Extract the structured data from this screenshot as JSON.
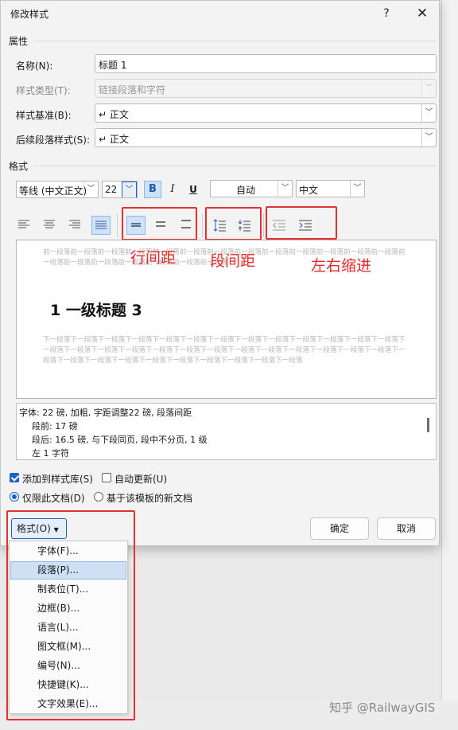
{
  "window": {
    "title": "修改样式",
    "help_icon": "?",
    "close_icon": "✕"
  },
  "properties": {
    "section_label": "属性",
    "name_label": "名称(N):",
    "name_value": "标题 1",
    "style_type_label": "样式类型(T):",
    "style_type_value": "链接段落和字符",
    "based_on_label": "样式基准(B):",
    "based_on_value": "↵ 正文",
    "following_label": "后续段落样式(S):",
    "following_value": "↵ 正文"
  },
  "formatting": {
    "section_label": "格式",
    "font_value": "等线 (中文正文)",
    "size_value": "22",
    "bold": "B",
    "italic": "I",
    "underline": "U",
    "color_value": "自动",
    "script_value": "中文"
  },
  "annotations": {
    "line_spacing": "行间距",
    "para_spacing": "段间距",
    "indent": "左右缩进"
  },
  "preview": {
    "prev_text": "前一段落前一段落前一段落前一段落前一段落前一段落前一段落前一段落前一段落前一段落前一段落前一段落前一段落前一段落前一段落前一段落前一段落前一段落前一段落前一段落",
    "heading": "1  一级标题 3",
    "next_text": "下一段落下一段落下一段落下一段落下一段落下一段落下一段落下一段落下一段落下一段落下一段落下一段落下一段落下一段落下一段落下一段落下一段落下一段落下一段落下一段落下一段落下一段落下一段落下一段落下一段落下一段落下一段落下一段落下一段落下一段落下一段落下一段落下一段落下一段落下一段落下一段落"
  },
  "description": {
    "line1": "字体: 22 磅, 加粗, 字距调整22 磅, 段落间距",
    "line2": "段前: 17 磅",
    "line3": "段后: 16.5 磅, 与下段同页, 段中不分页, 1 级",
    "line4": "左  1 字符"
  },
  "options": {
    "add_to_gallery": "添加到样式库(S)",
    "auto_update": "自动更新(U)",
    "only_this_doc": "仅限此文档(D)",
    "new_docs_template": "基于该模板的新文档"
  },
  "buttons": {
    "format": "格式(O)",
    "ok": "确定",
    "cancel": "取消"
  },
  "format_menu": [
    "字体(F)...",
    "段落(P)...",
    "制表位(T)...",
    "边框(B)...",
    "语言(L)...",
    "图文框(M)...",
    "编号(N)...",
    "快捷键(K)...",
    "文字效果(E)..."
  ],
  "watermark": "知乎 @RailwayGIS"
}
